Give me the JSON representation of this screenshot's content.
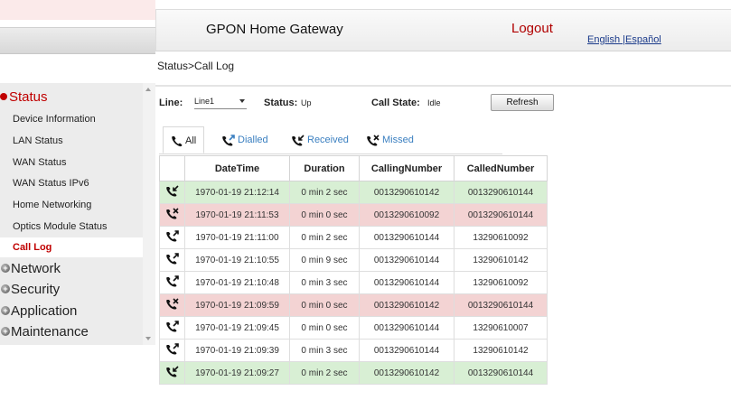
{
  "header": {
    "title": "GPON Home Gateway",
    "logout": "Logout",
    "lang_english": "English",
    "lang_sep": " |",
    "lang_spanish": "Español"
  },
  "breadcrumb": "Status>Call Log",
  "sidebar": {
    "status_label": "Status",
    "status_items": [
      "Device Information",
      "LAN Status",
      "WAN Status",
      "WAN Status IPv6",
      "Home Networking",
      "Optics Module Status",
      "Call Log"
    ],
    "selected_item": "Call Log",
    "other_menus": [
      "Network",
      "Security",
      "Application",
      "Maintenance"
    ]
  },
  "controls": {
    "line_label": "Line:",
    "line_value": "Line1",
    "status_label": "Status:",
    "status_value": "Up",
    "call_state_label": "Call State:",
    "call_state_value": "Idle",
    "refresh_label": "Refresh"
  },
  "tabs": [
    {
      "label": "All",
      "active": true
    },
    {
      "label": "Dialled",
      "active": false
    },
    {
      "label": "Received",
      "active": false
    },
    {
      "label": "Missed",
      "active": false
    }
  ],
  "table": {
    "columns": [
      "DateTime",
      "Duration",
      "CallingNumber",
      "CalledNumber"
    ],
    "rows": [
      {
        "type": "received",
        "datetime": "1970-01-19 21:12:14",
        "duration": "0 min 2 sec",
        "calling": "0013290610142",
        "called": "0013290610144"
      },
      {
        "type": "missed",
        "datetime": "1970-01-19 21:11:53",
        "duration": "0 min 0 sec",
        "calling": "0013290610092",
        "called": "0013290610144"
      },
      {
        "type": "dialled",
        "datetime": "1970-01-19 21:11:00",
        "duration": "0 min 2 sec",
        "calling": "0013290610144",
        "called": "13290610092"
      },
      {
        "type": "dialled",
        "datetime": "1970-01-19 21:10:55",
        "duration": "0 min 9 sec",
        "calling": "0013290610144",
        "called": "13290610142"
      },
      {
        "type": "dialled",
        "datetime": "1970-01-19 21:10:48",
        "duration": "0 min 3 sec",
        "calling": "0013290610144",
        "called": "13290610092"
      },
      {
        "type": "missed",
        "datetime": "1970-01-19 21:09:59",
        "duration": "0 min 0 sec",
        "calling": "0013290610142",
        "called": "0013290610144"
      },
      {
        "type": "dialled",
        "datetime": "1970-01-19 21:09:45",
        "duration": "0 min 0 sec",
        "calling": "0013290610144",
        "called": "13290610007"
      },
      {
        "type": "dialled",
        "datetime": "1970-01-19 21:09:39",
        "duration": "0 min 3 sec",
        "calling": "0013290610144",
        "called": "13290610142"
      },
      {
        "type": "received",
        "datetime": "1970-01-19 21:09:27",
        "duration": "0 min 2 sec",
        "calling": "0013290610142",
        "called": "0013290610144"
      }
    ]
  },
  "colors": {
    "accent_red": "#c00000",
    "received_row": "#d8efd4",
    "missed_row": "#f3d3d3",
    "link_blue": "#3a7fc0"
  },
  "icons": {
    "all_tab": "phone-icon",
    "dialled_tab": "phone-outgoing-icon",
    "received_tab": "phone-incoming-icon",
    "missed_tab": "phone-missed-icon"
  }
}
